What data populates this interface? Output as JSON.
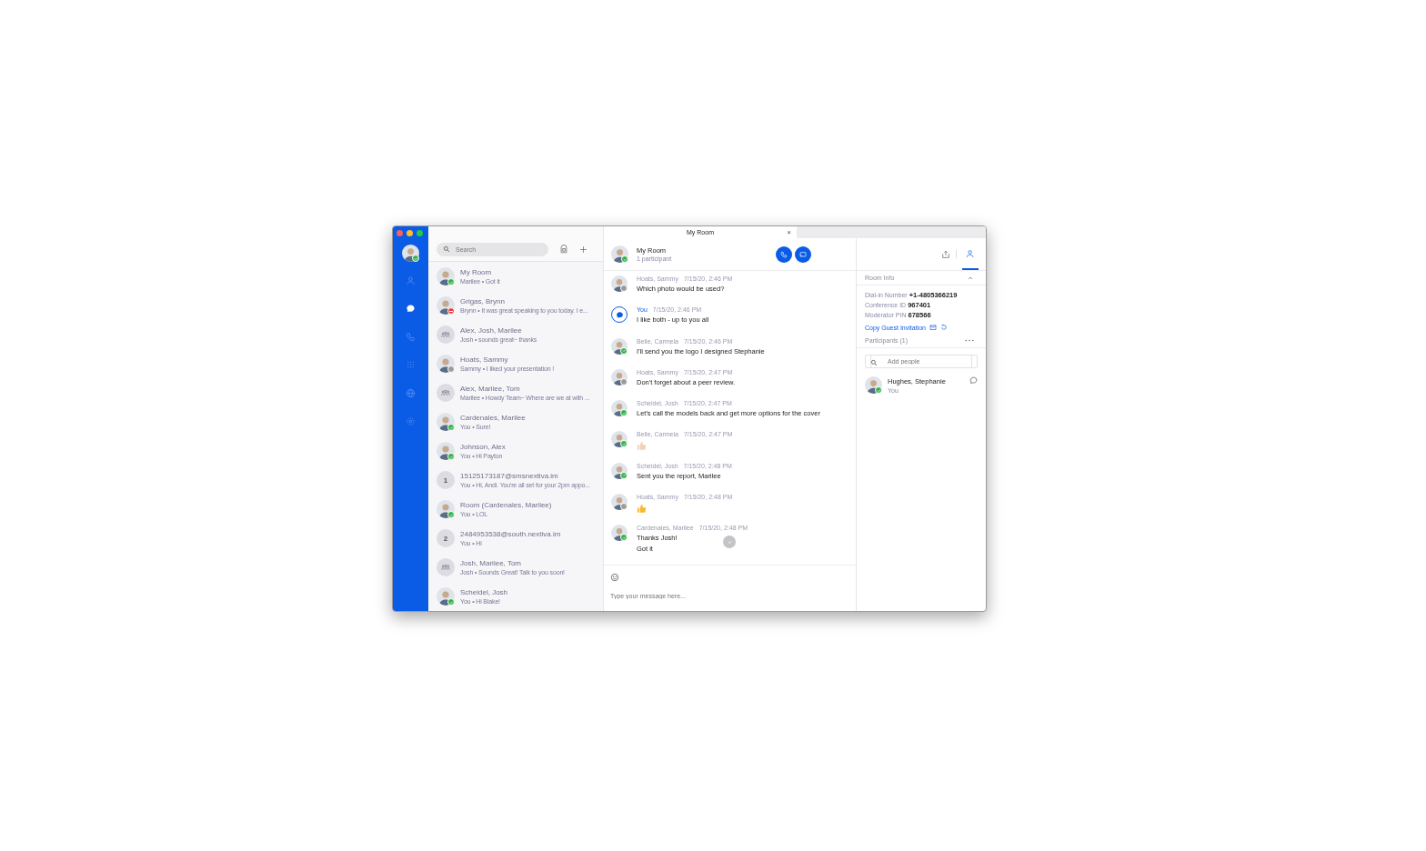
{
  "rail": {
    "user": {
      "kind": "photo",
      "presence": {
        "kind": "online",
        "color": "#2fb344"
      }
    },
    "nav": [
      {
        "kind": "person",
        "selected": false
      },
      {
        "kind": "chat",
        "selected": true
      },
      {
        "kind": "phone",
        "selected": false
      },
      {
        "kind": "dialpad",
        "selected": false
      },
      {
        "kind": "globe",
        "selected": false
      },
      {
        "kind": "gear",
        "selected": false
      }
    ]
  },
  "conversation_list": {
    "search": {
      "placeholder": "Search"
    },
    "items": [
      {
        "name": "My Room",
        "preview": "Marilee • Got it",
        "avatar": {
          "kind": "photo",
          "presence": {
            "kind": "online",
            "color": "#2fb344"
          }
        }
      },
      {
        "name": "Grigas, Brynn",
        "preview": "Brynn • It was great speaking to you today. I e...",
        "avatar": {
          "kind": "photo",
          "presence": {
            "kind": "busy",
            "color": "#ef3d3d"
          }
        }
      },
      {
        "name": "Alex, Josh, Marilee",
        "preview": "Josh • sounds great~ thanks",
        "avatar": {
          "kind": "group"
        }
      },
      {
        "name": "Hoats, Sammy",
        "preview": "Sammy • I liked your presentation !",
        "avatar": {
          "kind": "photo",
          "presence": {
            "kind": "away",
            "color": "#9b9b9b"
          }
        }
      },
      {
        "name": "Alex, Marilee, Tom",
        "preview": "Marilee • Howdy Team~ Where are we at with ...",
        "avatar": {
          "kind": "group"
        }
      },
      {
        "name": "Cardenales, Marilee",
        "preview": "You • Sure!",
        "avatar": {
          "kind": "photo",
          "presence": {
            "kind": "online",
            "color": "#2fb344"
          }
        }
      },
      {
        "name": "Johnson, Alex",
        "preview": "You • Hi Payton",
        "avatar": {
          "kind": "photo",
          "presence": {
            "kind": "online",
            "color": "#2fb344"
          }
        }
      },
      {
        "name": "15125173187@smsnextiva.im",
        "preview": "You • Hi, Andi. You're all set for your 2pm appo...",
        "avatar": {
          "kind": "number",
          "label": "1"
        }
      },
      {
        "name": "Room (Cardenales, Marilee)",
        "preview": "You • LOL",
        "avatar": {
          "kind": "photo",
          "presence": {
            "kind": "online",
            "color": "#2fb344"
          }
        }
      },
      {
        "name": "2484953538@south.nextiva.im",
        "preview": "You • Hi",
        "avatar": {
          "kind": "number",
          "label": "2"
        }
      },
      {
        "name": "Josh, Marilee, Tom",
        "preview": "Josh • Sounds Great! Talk to you soon!",
        "avatar": {
          "kind": "group"
        }
      },
      {
        "name": "Scheidel, Josh",
        "preview": "You • Hi Blake!",
        "avatar": {
          "kind": "photo",
          "presence": {
            "kind": "online",
            "color": "#2fb344"
          }
        }
      }
    ]
  },
  "tab": {
    "title": "My Room",
    "close": "×"
  },
  "room_header": {
    "title": "My Room",
    "subtitle": "1 participant",
    "avatar": {
      "kind": "photo",
      "presence": {
        "kind": "online",
        "color": "#2fb344"
      }
    }
  },
  "messages": [
    {
      "sender": "Hoats, Sammy",
      "time": "7/15/20, 2:46 PM",
      "kind": "text",
      "lines": [
        "Which photo would be used?"
      ],
      "avatar": {
        "kind": "photo",
        "presence": {
          "kind": "away",
          "color": "#9b9b9b"
        }
      }
    },
    {
      "sender": "You",
      "time": "7/15/20, 2:46 PM",
      "kind": "text",
      "lines": [
        "I like both - up to you all"
      ],
      "avatar": {
        "kind": "self"
      }
    },
    {
      "sender": "Beile, Carmela",
      "time": "7/15/20, 2:46 PM",
      "kind": "text",
      "lines": [
        "I'll send you the logo I designed Stephanie"
      ],
      "avatar": {
        "kind": "photo",
        "presence": {
          "kind": "online",
          "color": "#2fb344"
        }
      }
    },
    {
      "sender": "Hoats, Sammy",
      "time": "7/15/20, 2:47 PM",
      "kind": "text",
      "lines": [
        "Don't forget about a peer review."
      ],
      "avatar": {
        "kind": "photo",
        "presence": {
          "kind": "away",
          "color": "#9b9b9b"
        }
      }
    },
    {
      "sender": "Scheidel, Josh",
      "time": "7/15/20, 2:47 PM",
      "kind": "text",
      "lines": [
        "Let's call the models back and get more options for the cover"
      ],
      "avatar": {
        "kind": "photo",
        "presence": {
          "kind": "online",
          "color": "#2fb344"
        }
      }
    },
    {
      "sender": "Beile, Carmela",
      "time": "7/15/20, 2:47 PM",
      "kind": "thumbs",
      "color": "#f3cfb3",
      "avatar": {
        "kind": "photo",
        "presence": {
          "kind": "online",
          "color": "#2fb344"
        }
      }
    },
    {
      "sender": "Scheidel, Josh",
      "time": "7/15/20, 2:48 PM",
      "kind": "text",
      "lines": [
        "Sent you the report, Marilee"
      ],
      "avatar": {
        "kind": "photo",
        "presence": {
          "kind": "online",
          "color": "#2fb344"
        }
      }
    },
    {
      "sender": "Hoats, Sammy",
      "time": "7/15/20, 2:48 PM",
      "kind": "thumbs",
      "color": "#f7b928",
      "avatar": {
        "kind": "photo",
        "presence": {
          "kind": "away",
          "color": "#9b9b9b"
        }
      }
    },
    {
      "sender": "Cardenales, Marilee",
      "time": "7/15/20, 2:48 PM",
      "kind": "text",
      "lines": [
        "Thanks Josh!",
        "Got it"
      ],
      "avatar": {
        "kind": "photo",
        "presence": {
          "kind": "online",
          "color": "#2fb344"
        }
      }
    }
  ],
  "composer": {
    "placeholder": "Type your message here..."
  },
  "side_panel": {
    "room_info": {
      "title": "Room Info",
      "expanded": true,
      "fields": [
        {
          "label": "Dial-in Number",
          "value": "+1-4805366219"
        },
        {
          "label": "Conference ID",
          "value": "967401"
        },
        {
          "label": "Moderator PIN",
          "value": "678566"
        }
      ],
      "link": "Copy Guest Invitation"
    },
    "participants": {
      "title": "Participants (1)",
      "search": {
        "placeholder": "Add people"
      },
      "items": [
        {
          "name": "Hughes, Stephanie",
          "note": "You",
          "avatar": {
            "kind": "photo",
            "presence": {
              "kind": "online",
              "color": "#2fb344"
            }
          }
        }
      ]
    }
  }
}
